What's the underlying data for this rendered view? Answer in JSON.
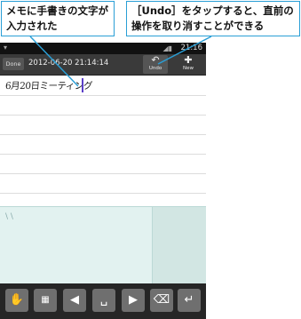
{
  "callouts": {
    "left_line1": "メモに手書きの文字が",
    "left_line2": "入力された",
    "right_line1": "［Undo］をタップすると、直前の",
    "right_line2": "操作を取り消すことができる"
  },
  "status_bar": {
    "time": "21:16"
  },
  "toolbar": {
    "done_label": "Done",
    "date": "2012-06-20 21:14:14",
    "undo_label": "Undo",
    "new_label": "New",
    "undo_icon": "undo-icon",
    "new_icon": "plus-icon"
  },
  "memo": {
    "handwritten_text": "6月20日ミーティング"
  },
  "keyboard": {
    "keys": [
      "settings-icon",
      "grid-keyboard-icon",
      "arrow-left-icon",
      "space-icon",
      "arrow-right-icon",
      "backspace-icon",
      "enter-icon"
    ]
  },
  "colors": {
    "callout_border": "#2a9fd6",
    "cursor": "#5b3fc8",
    "pad_bg": "#e2f2f0"
  }
}
